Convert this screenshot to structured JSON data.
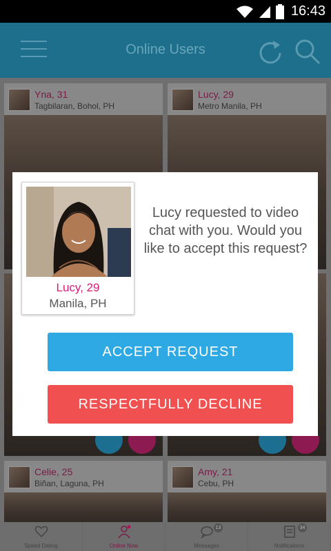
{
  "status_bar": {
    "time": "16:43"
  },
  "app_bar": {
    "title": "Online Users"
  },
  "cards": [
    {
      "name": "Yna, 31",
      "location": "Tagbilaran, Bohol, PH"
    },
    {
      "name": "Lucy, 29",
      "location": "Metro Manila, PH"
    },
    {
      "name": "Celie, 25",
      "location": "Biñan, Laguna, PH"
    },
    {
      "name": "Amy, 21",
      "location": "Cebu, PH"
    }
  ],
  "bottom_nav": {
    "items": [
      {
        "label": "Speed Dating"
      },
      {
        "label": "Online Now"
      },
      {
        "label": "Messages",
        "badge": "13"
      },
      {
        "label": "Notifications",
        "badge": "34"
      }
    ]
  },
  "modal": {
    "profile_name": "Lucy, 29",
    "profile_location": "Manila, PH",
    "message": "Lucy requested to video chat with you. Would you like to accept this request?",
    "accept_label": "ACCEPT REQUEST",
    "decline_label": "RESPECTFULLY DECLINE"
  },
  "colors": {
    "accent_pink": "#d81b7a",
    "accept_blue": "#2ea9e3",
    "decline_red": "#f05050",
    "appbar_teal": "#1d6f8c"
  }
}
